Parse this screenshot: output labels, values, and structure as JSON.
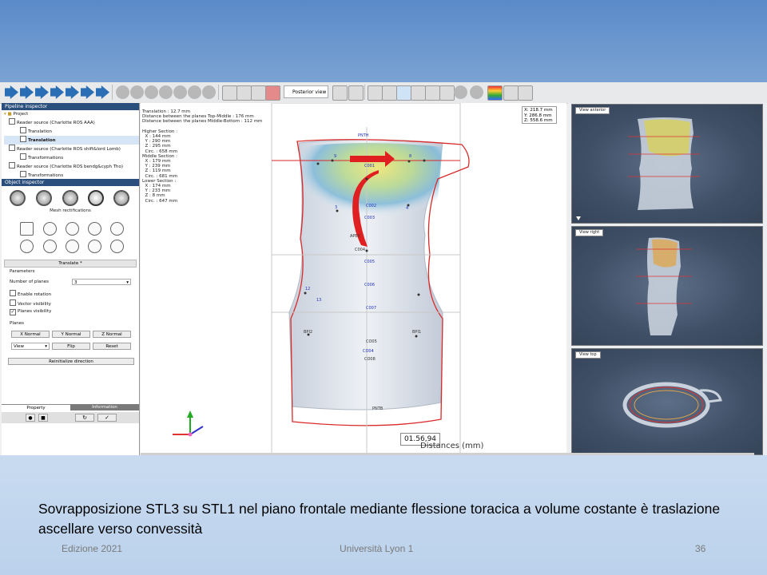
{
  "toolbar": {
    "view_select": "Posterior view"
  },
  "pipeline_inspector": {
    "title": "Pipeline inspector",
    "items": [
      {
        "label": "Project",
        "indent": 0
      },
      {
        "label": "Reader source (Charlotte ROS AAA)",
        "indent": 1
      },
      {
        "label": "Translation",
        "indent": 2
      },
      {
        "label": "Translation",
        "indent": 2,
        "selected": true
      },
      {
        "label": "Reader source (Charlotte ROS shift&lord Lomb)",
        "indent": 1
      },
      {
        "label": "Transformations",
        "indent": 2
      },
      {
        "label": "Reader source (Charlotte ROS bendg&cyph Tho)",
        "indent": 1
      },
      {
        "label": "Transformations",
        "indent": 2
      }
    ]
  },
  "object_inspector": {
    "title": "Object inspector",
    "mesh_label": "Mesh rectifications",
    "translate_label": "Translate *",
    "parameters_label": "Parameters",
    "number_of_planes_label": "Number of planes",
    "number_of_planes_value": "3",
    "enable_rotation": "Enable rotation",
    "vector_visibility": "Vector visibility",
    "planes_visibility": "Planes visibility",
    "planes_label": "Planes",
    "x_normal": "X Normal",
    "y_normal": "Y Normal",
    "z_normal": "Z Normal",
    "view_select": "View",
    "flip": "Flip",
    "reset": "Reset",
    "reinitialize": "Reinitialize direction",
    "tab_property": "Property",
    "tab_information": "Information"
  },
  "viewport": {
    "info_text": "Translation : 12.7 mm\nDistance between the planes Top-Middle : 176 mm\nDistance between the planes Middle-Bottom : 112 mm\n\nHigher Section :\n  X : 144 mm\n  Y : 290 mm\n  Z : 295 mm\n  Circ. : 658 mm\nMiddle Section :\n  X : 179 mm\n  Y : 239 mm\n  Z : 119 mm\n  Circ. : 681 mm\nLower Section :\n  X : 174 mm\n  Y : 233 mm\n  Z : 8 mm\n  Circ. : 647 mm",
    "coord_x": "X: 218.7 mm",
    "coord_y": "Y: 286.8 mm",
    "coord_z": "Z: 558.6 mm",
    "measure": "01.56,94",
    "distance_label": "Distances (mm)",
    "landmarks": [
      "PNTH",
      "C001",
      "C002",
      "C003",
      "APEX",
      "C004",
      "C005",
      "C006",
      "C007",
      "BPI2",
      "BPI1",
      "CO05",
      "CO04",
      "CO08",
      "PNTB",
      "3",
      "4",
      "8",
      "9",
      "12",
      "13"
    ]
  },
  "right_views": {
    "anterior": "View anterior",
    "right": "View right",
    "top": "View top"
  },
  "caption": "Sovrapposizione STL3 su STL1 nel piano frontale mediante flessione toracica a volume costante è traslazione ascellare verso convessità",
  "footer": {
    "left": "Edizione 2021",
    "center": "Università Lyon 1",
    "right": "36"
  }
}
